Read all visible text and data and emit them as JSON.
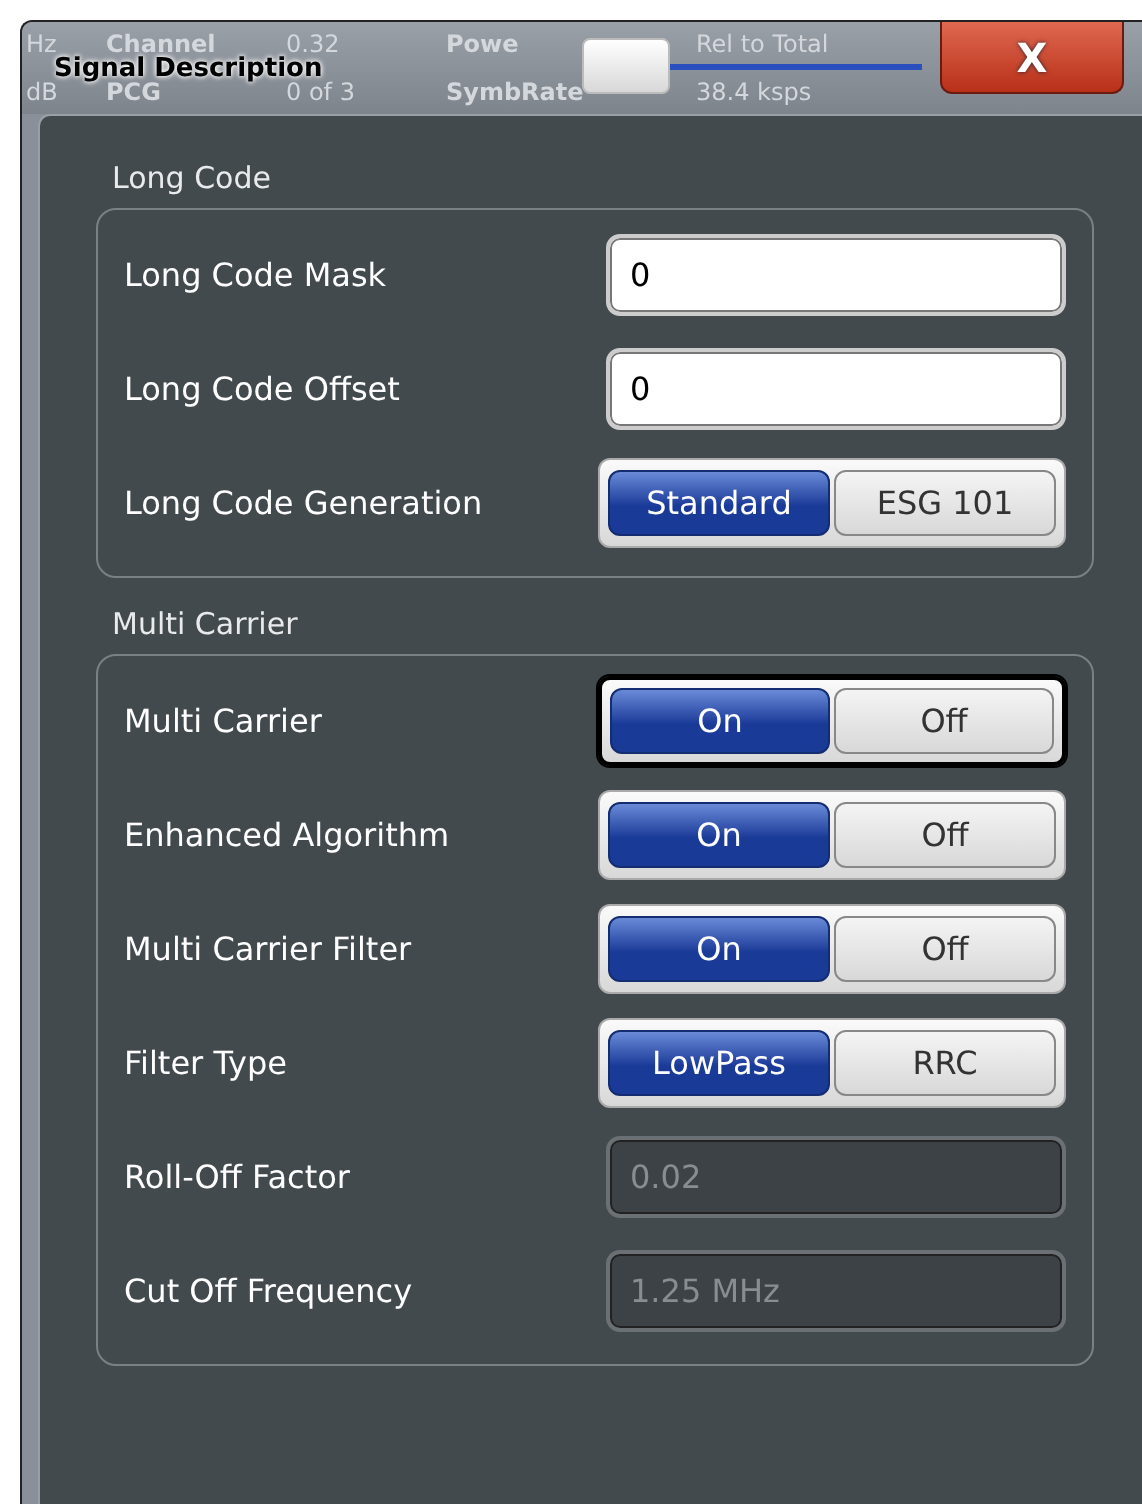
{
  "background_readout": {
    "row_1": [
      "Hz",
      "Channel",
      "0.32",
      "Powe",
      "Rel to Total"
    ],
    "row_2": [
      "dB",
      "PCG",
      "0 of 3",
      "SymbRate",
      "38.4 ksps"
    ]
  },
  "dialog": {
    "title": "Signal Description",
    "close": "X"
  },
  "sections": [
    {
      "title": "Long Code",
      "rows": [
        {
          "kind": "field",
          "label": "Long Code Mask",
          "value": "0",
          "disabled": false
        },
        {
          "kind": "field",
          "label": "Long Code Offset",
          "value": "0",
          "disabled": false
        },
        {
          "kind": "toggle",
          "label": "Long Code Generation",
          "focused": false,
          "options": [
            {
              "label": "Standard",
              "selected": true
            },
            {
              "label": "ESG 101",
              "selected": false
            }
          ]
        }
      ]
    },
    {
      "title": "Multi Carrier",
      "rows": [
        {
          "kind": "toggle",
          "label": "Multi Carrier",
          "focused": true,
          "options": [
            {
              "label": "On",
              "selected": true
            },
            {
              "label": "Off",
              "selected": false
            }
          ]
        },
        {
          "kind": "toggle",
          "label": "Enhanced Algorithm",
          "focused": false,
          "options": [
            {
              "label": "On",
              "selected": true
            },
            {
              "label": "Off",
              "selected": false
            }
          ]
        },
        {
          "kind": "toggle",
          "label": "Multi Carrier Filter",
          "focused": false,
          "options": [
            {
              "label": "On",
              "selected": true
            },
            {
              "label": "Off",
              "selected": false
            }
          ]
        },
        {
          "kind": "toggle",
          "label": "Filter Type",
          "focused": false,
          "options": [
            {
              "label": "LowPass",
              "selected": true
            },
            {
              "label": "RRC",
              "selected": false
            }
          ]
        },
        {
          "kind": "field",
          "label": "Roll-Off Factor",
          "value": "0.02",
          "disabled": true
        },
        {
          "kind": "field",
          "label": "Cut Off Frequency",
          "value": "1.25 MHz",
          "disabled": true
        }
      ]
    }
  ]
}
